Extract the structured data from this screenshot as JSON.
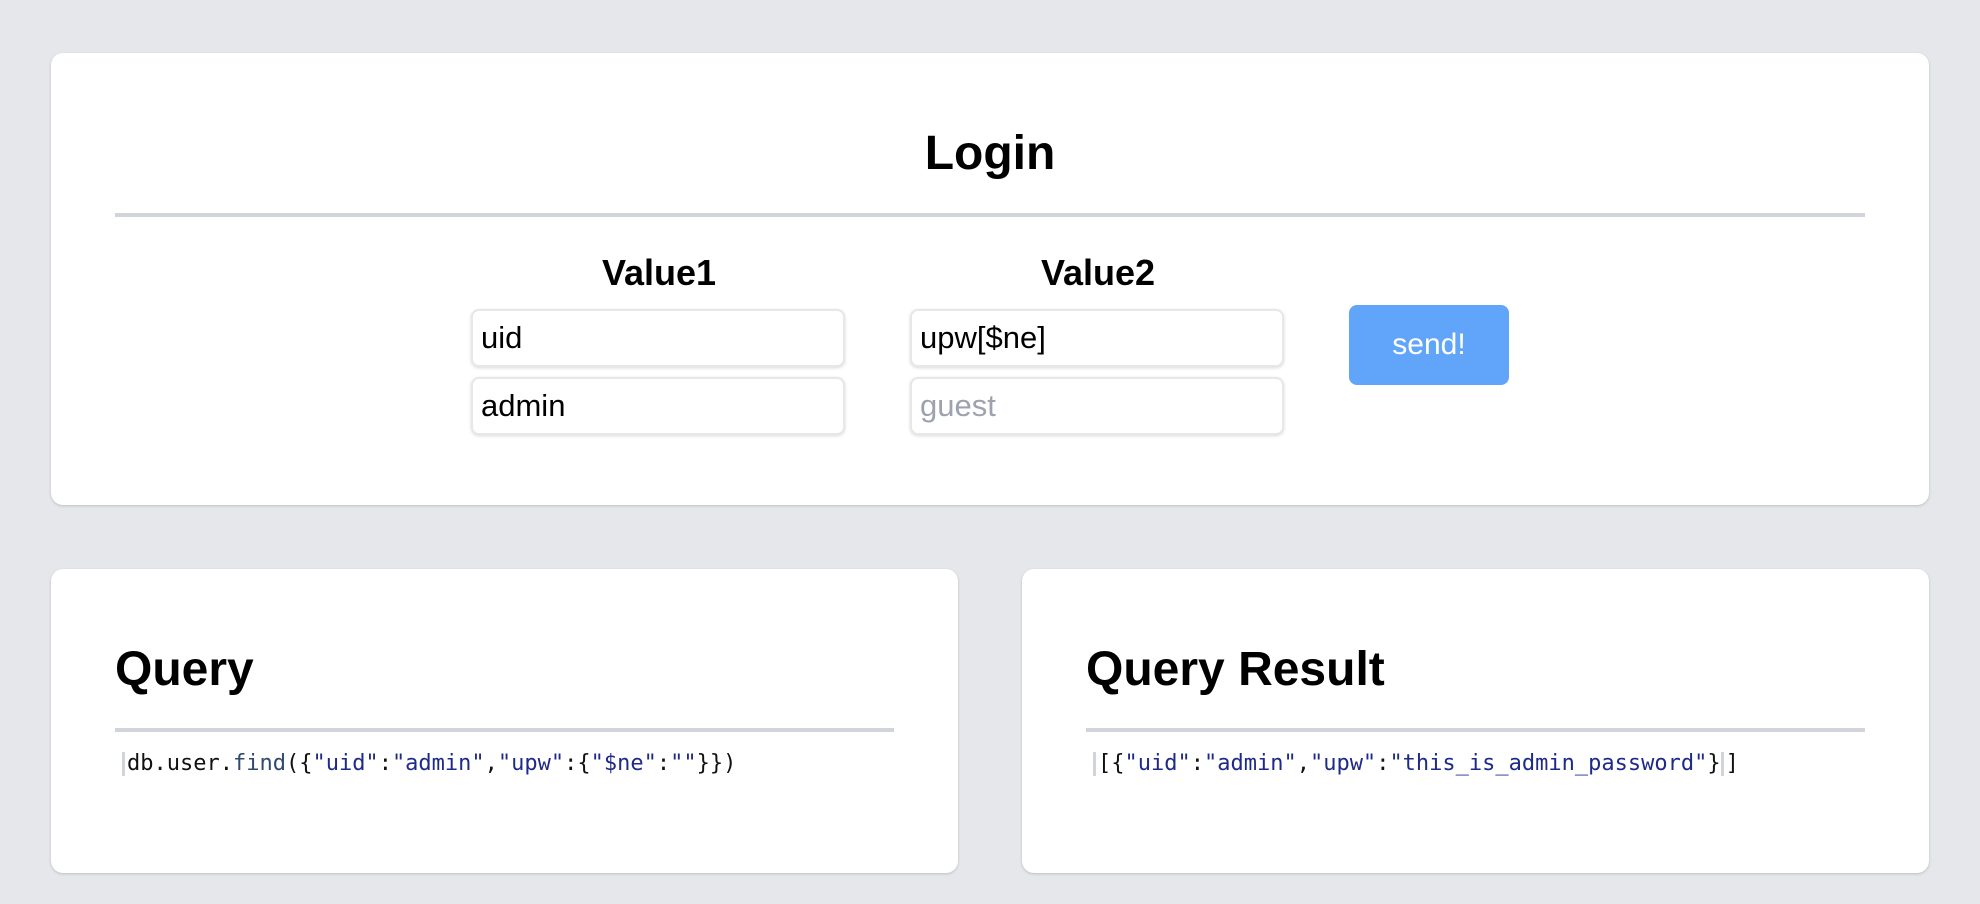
{
  "login": {
    "title": "Login",
    "value1": {
      "label": "Value1",
      "key_value": "uid",
      "val_value": "admin"
    },
    "value2": {
      "label": "Value2",
      "key_value": "upw[$ne]",
      "val_value": "",
      "val_placeholder": "guest"
    },
    "send_label": "send!"
  },
  "query": {
    "title": "Query",
    "code": {
      "prefix": "db.user.",
      "fn": "find",
      "p1": "({",
      "k1": "\"uid\"",
      "c1": ":",
      "v1": "\"admin\"",
      "c2": ",",
      "k2": "\"upw\"",
      "c3": ":{",
      "k3": "\"$ne\"",
      "c4": ":",
      "v3": "\"\"",
      "p2": "}})"
    }
  },
  "result": {
    "title": "Query Result",
    "code": {
      "p1": "[{",
      "k1": "\"uid\"",
      "c1": ":",
      "v1": "\"admin\"",
      "c2": ",",
      "k2": "\"upw\"",
      "c3": ":",
      "v2": "\"this_is_admin_password\"",
      "p2": "}",
      "p3": "]"
    }
  },
  "colors": {
    "page_bg": "#e5e7eb",
    "card_bg": "#ffffff",
    "button_bg": "#60a5fa",
    "divider": "#d1d5db",
    "string_color": "#1e2a8a"
  }
}
